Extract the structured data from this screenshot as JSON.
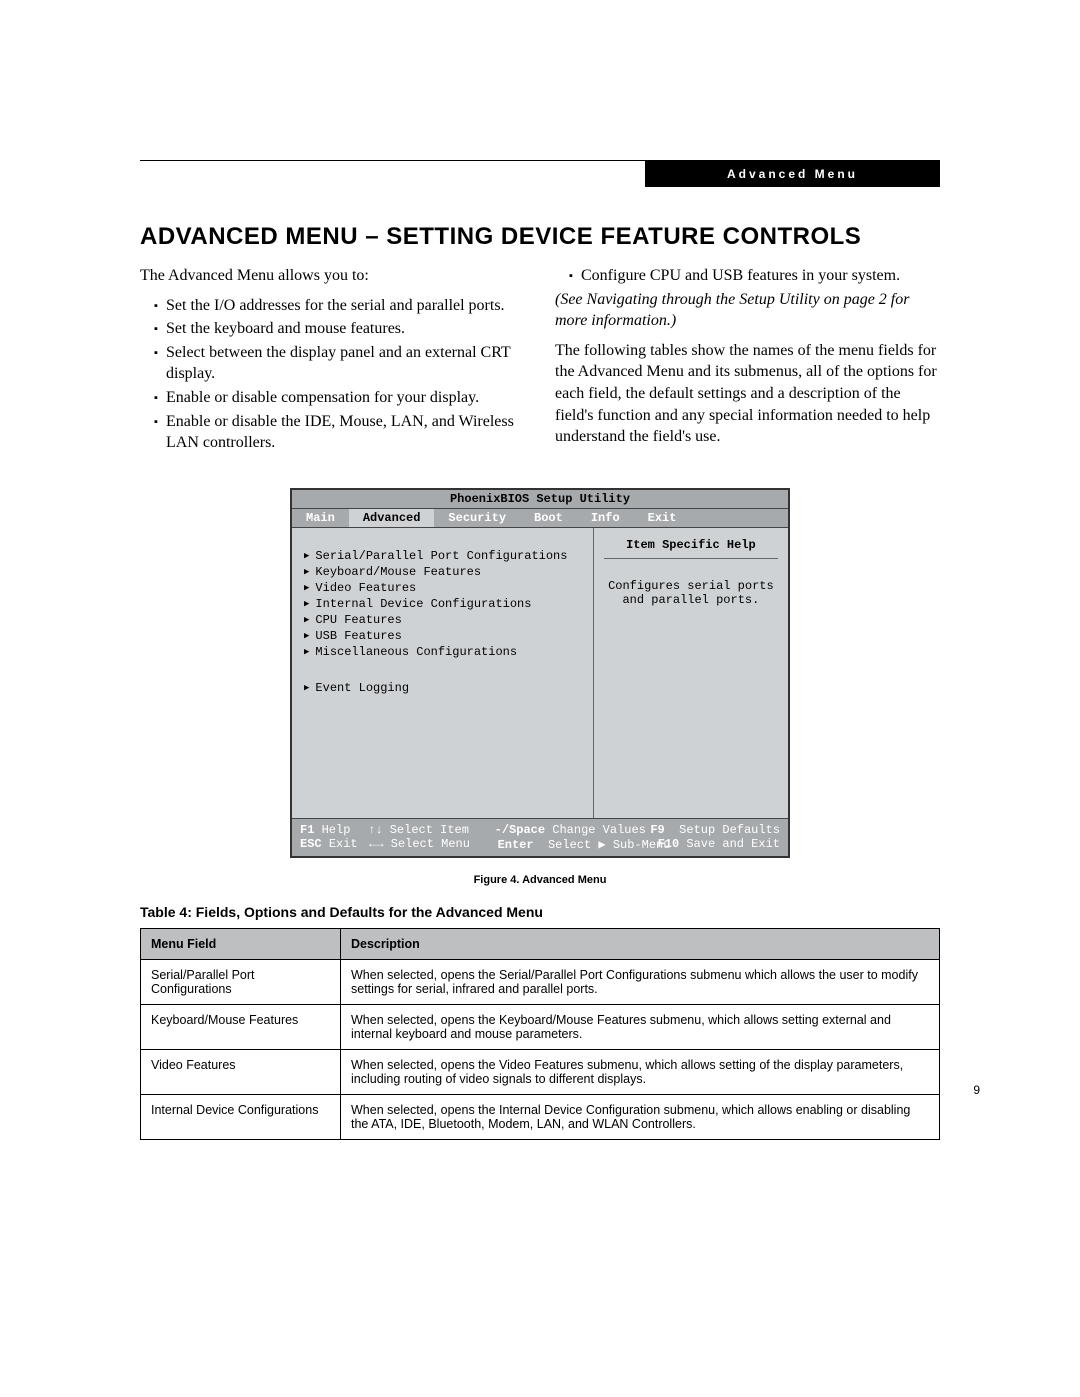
{
  "header": {
    "label": "Advanced Menu"
  },
  "title": "ADVANCED MENU – SETTING DEVICE FEATURE CONTROLS",
  "intro": "The Advanced Menu allows you to:",
  "left_bullets": [
    "Set the I/O addresses for the serial and parallel ports.",
    "Set the keyboard and mouse features.",
    "Select between the display panel and an external CRT display.",
    "Enable or disable compensation for your display.",
    "Enable or disable the IDE, Mouse, LAN, and Wireless LAN controllers."
  ],
  "right_bullet": "Configure CPU and USB features in your system.",
  "right_italic": "(See Navigating through the Setup Utility on page 2 for more information.)",
  "right_paragraph": "The following tables show the names of the menu fields for the Advanced Menu and its submenus, all of the options for each field, the default settings and a description of the field's function and any special information needed to help understand the field's use.",
  "bios": {
    "title": "PhoenixBIOS Setup Utility",
    "tabs": [
      "Main",
      "Advanced",
      "Security",
      "Boot",
      "Info",
      "Exit"
    ],
    "selected_tab": "Advanced",
    "items_a": [
      "Serial/Parallel Port Configurations",
      "Keyboard/Mouse Features",
      "Video Features",
      "Internal Device Configurations",
      "CPU Features",
      "USB Features",
      "Miscellaneous Configurations"
    ],
    "items_b": [
      "Event Logging"
    ],
    "help_title": "Item Specific Help",
    "help_text_1": "Configures serial ports",
    "help_text_2": "and parallel ports.",
    "footer": {
      "f1": "F1",
      "help": "Help",
      "esc": "ESC",
      "exit": "Exit",
      "select_item_arrows": "↑↓",
      "select_item": "Select Item",
      "select_menu_arrows": "←→",
      "select_menu": "Select Menu",
      "minus_space": "-/Space",
      "change_values": "Change Values",
      "enter": "Enter",
      "select_sub": "Select ▶ Sub-Menu",
      "f9": "F9",
      "setup_defaults": "Setup Defaults",
      "f10": "F10",
      "save_exit": "Save and Exit"
    }
  },
  "figure_caption": "Figure 4.  Advanced Menu",
  "table_title": "Table 4: Fields, Options and Defaults for the Advanced Menu",
  "table": {
    "headers": [
      "Menu Field",
      "Description"
    ],
    "rows": [
      {
        "field": "Serial/Parallel Port Configurations",
        "desc": "When selected, opens the Serial/Parallel Port Configurations submenu which allows the user to modify settings for serial, infrared and parallel ports."
      },
      {
        "field": "Keyboard/Mouse Features",
        "desc": "When selected, opens the Keyboard/Mouse Features submenu, which allows setting external and internal keyboard and mouse parameters."
      },
      {
        "field": "Video Features",
        "desc": "When selected, opens the Video Features submenu, which allows setting of the display parameters, including routing of video signals to different displays."
      },
      {
        "field": "Internal Device Configurations",
        "desc": "When selected, opens the Internal Device Configuration submenu, which allows enabling or disabling the ATA, IDE, Bluetooth, Modem, LAN, and WLAN Controllers."
      }
    ]
  },
  "page_number": "9"
}
